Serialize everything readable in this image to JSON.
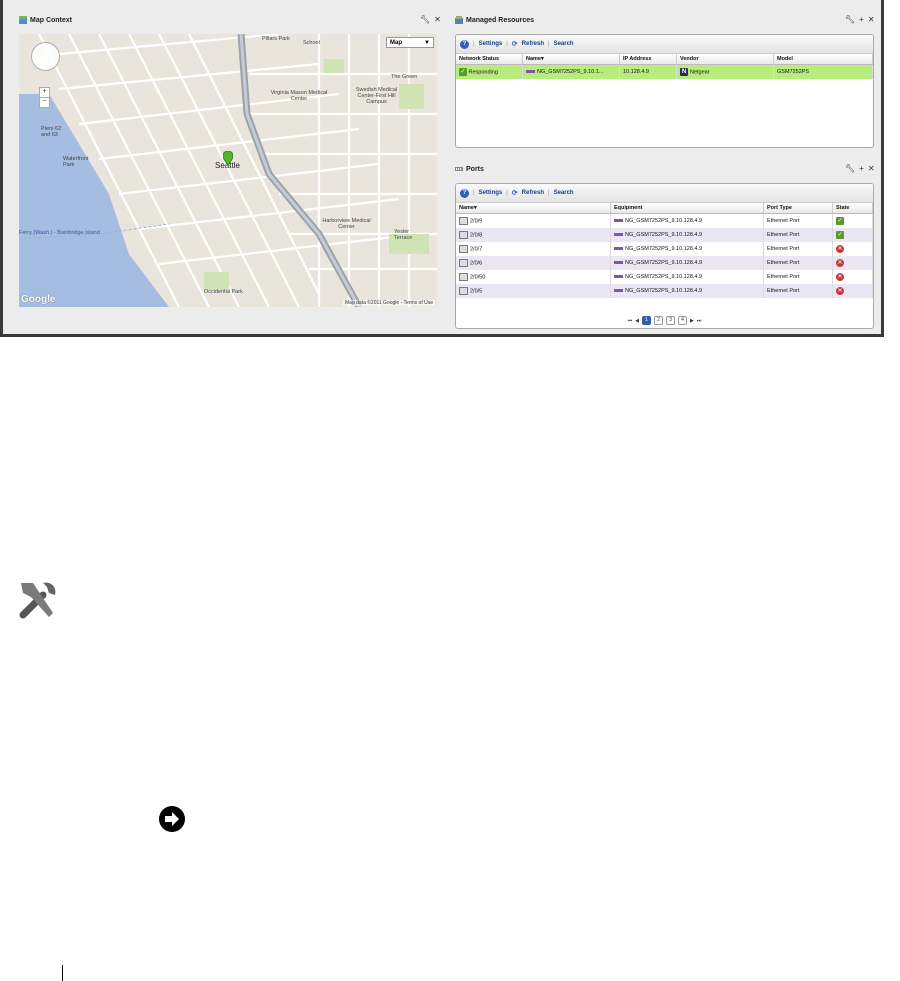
{
  "map_portlet": {
    "title": "Map Context",
    "map_type": "Map",
    "labels": {
      "pillars_park": "Pillars Park",
      "school": "School",
      "virginia_mason": "Virginia Mason Medical Center",
      "swedish": "Swedish Medical Center-First Hill Campus",
      "the_green": "The Green",
      "piers": "Piers 62 and 63",
      "waterfront": "Waterfront Park",
      "seattle": "Seattle",
      "harborview": "Harborview Medical Center",
      "yesler": "Yesler Terrace",
      "occidental": "Occidental Park",
      "ferry": "Ferry (Wash.) - Bainbridge Island"
    },
    "google": "Google",
    "map_data": "Map data ©2011 Google - Terms of Use"
  },
  "managed_resources": {
    "title": "Managed Resources",
    "toolbar": {
      "settings": "Settings",
      "refresh": "Refresh",
      "search": "Search"
    },
    "columns": [
      "Network Status",
      "Name",
      "IP Address",
      "Vendor",
      "Model"
    ],
    "rows": [
      {
        "status": "Responding",
        "name": "NG_GSM7252PS_9.10.1...",
        "ip": "10.128.4.9",
        "vendor": "Netgear",
        "vendor_icon": "N",
        "model": "GSM7252PS"
      }
    ]
  },
  "ports": {
    "title": "Ports",
    "toolbar": {
      "settings": "Settings",
      "refresh": "Refresh",
      "search": "Search"
    },
    "columns": [
      "Name",
      "Equipment",
      "Port Type",
      "State"
    ],
    "rows": [
      {
        "name": "2/0/9",
        "equipment": "NG_GSM7252PS_9.10.128.4.9",
        "type": "Ethernet Port",
        "state": "up"
      },
      {
        "name": "2/0/8",
        "equipment": "NG_GSM7252PS_9.10.128.4.9",
        "type": "Ethernet Port",
        "state": "up"
      },
      {
        "name": "2/0/7",
        "equipment": "NG_GSM7252PS_9.10.128.4.9",
        "type": "Ethernet Port",
        "state": "down"
      },
      {
        "name": "2/0/6",
        "equipment": "NG_GSM7252PS_9.10.128.4.9",
        "type": "Ethernet Port",
        "state": "down"
      },
      {
        "name": "2/0/50",
        "equipment": "NG_GSM7252PS_9.10.128.4.9",
        "type": "Ethernet Port",
        "state": "down"
      },
      {
        "name": "2/0/5",
        "equipment": "NG_GSM7252PS_9.10.128.4.9",
        "type": "Ethernet Port",
        "state": "down"
      }
    ],
    "pages": [
      "1",
      "2",
      "3",
      "4"
    ],
    "current_page": "1"
  },
  "colors": {
    "selected_row": "#b9ec7f",
    "alt_row": "#ebe6f4",
    "link": "#1a3e7c"
  }
}
